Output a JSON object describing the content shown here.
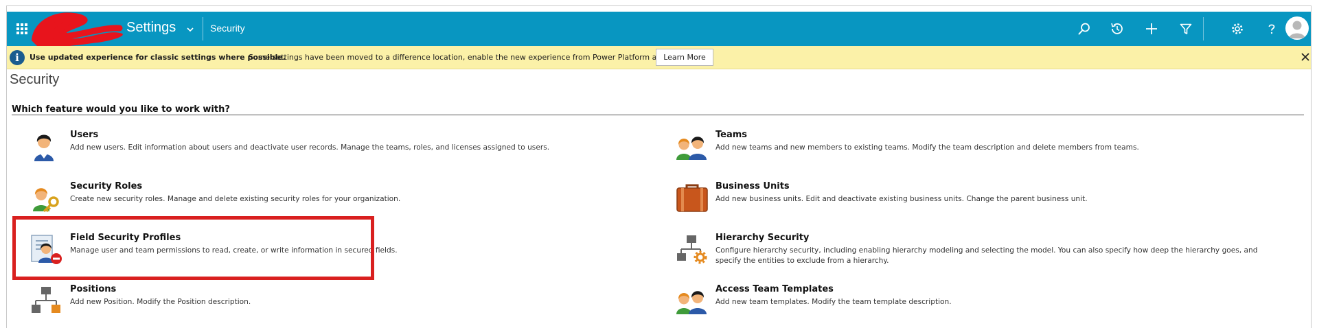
{
  "header": {
    "app_title": "Settings",
    "breadcrumb": "Security",
    "icons": [
      "app-launcher-icon",
      "chevron-down-icon",
      "search-icon",
      "history-icon",
      "plus-icon",
      "filter-icon",
      "gear-icon",
      "help-icon",
      "avatar"
    ]
  },
  "banner": {
    "strong_text": "Use updated experience for classic settings where possible.",
    "text": "Some settings have been moved to a difference location, enable the new experience from Power Platform admin center.",
    "button_label": "Learn More"
  },
  "page": {
    "title": "Security",
    "section_heading": "Which feature would you like to work with?"
  },
  "features": [
    {
      "title": "Users",
      "description": "Add new users. Edit information about users and deactivate user records. Manage the teams, roles, and licenses assigned to users.",
      "icon": "user-icon"
    },
    {
      "title": "Teams",
      "description": "Add new teams and new members to existing teams. Modify the team description and delete members from teams.",
      "icon": "team-icon"
    },
    {
      "title": "Security Roles",
      "description": "Create new security roles. Manage and delete existing security roles for your organization.",
      "icon": "security-role-icon"
    },
    {
      "title": "Business Units",
      "description": "Add new business units. Edit and deactivate existing business units. Change the parent business unit.",
      "icon": "briefcase-icon"
    },
    {
      "title": "Field Security Profiles",
      "description": "Manage user and team permissions to read, create, or write information in secured fields.",
      "icon": "field-security-icon"
    },
    {
      "title": "Hierarchy Security",
      "description": "Configure hierarchy security, including enabling hierarchy modeling and selecting the model. You can also specify how deep the hierarchy goes, and specify the entities to exclude from a hierarchy.",
      "icon": "hierarchy-security-icon"
    },
    {
      "title": "Positions",
      "description": "Add new Position. Modify the Position description.",
      "icon": "hierarchy-icon"
    },
    {
      "title": "Access Team Templates",
      "description": "Add new team templates. Modify the team template description.",
      "icon": "team-icon"
    }
  ],
  "colors": {
    "topbar": "#0896c1",
    "banner": "#fbf1a8",
    "highlight": "#d9201f"
  }
}
